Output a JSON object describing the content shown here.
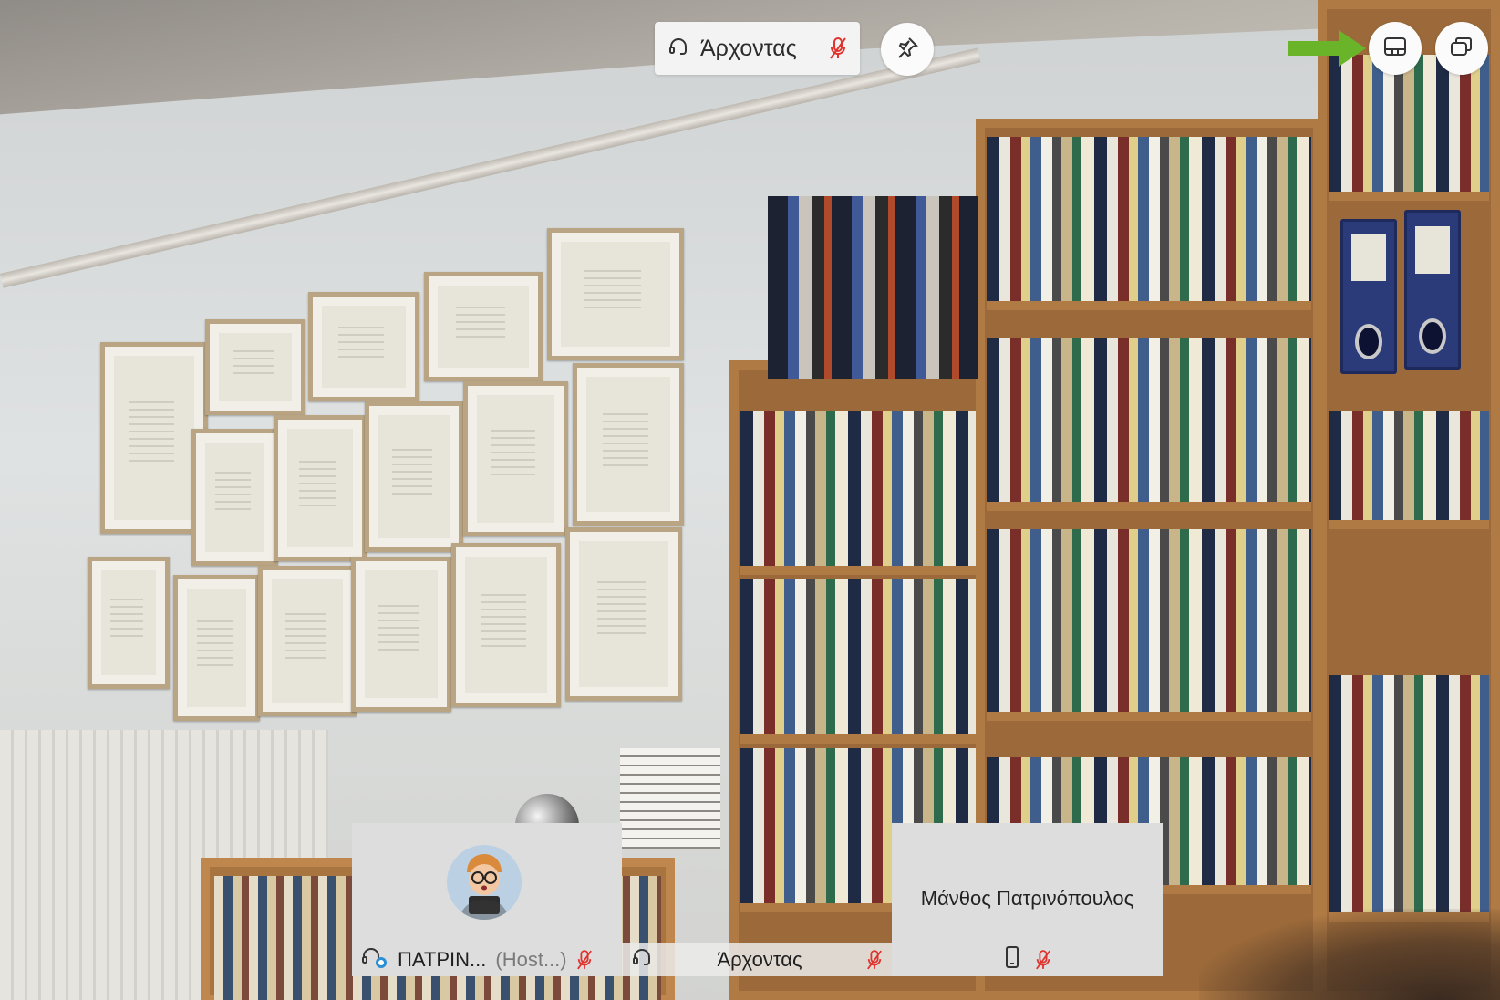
{
  "active_speaker": {
    "name": "Άρχοντας"
  },
  "top_right": {
    "layout_icon": "panel-layout-icon",
    "popout_icon": "popout-window-icon",
    "arrow_color": "#6ab42a"
  },
  "participants": [
    {
      "name": "ΠΑΤΡΙΝ...",
      "role": "(Host...)",
      "device_icon": "headset-linked-icon",
      "mic": "muted"
    },
    {
      "name": "Άρχοντας",
      "device_icon": "headset-icon",
      "mic": "muted"
    },
    {
      "name": "Μάνθος Πατρινόπουλος",
      "device_icon": "phone-icon",
      "mic": "muted"
    }
  ],
  "colors": {
    "mute_red": "#e0332d",
    "chip_bg": "#f3f3f3",
    "tile_bg": "#dddddd"
  }
}
